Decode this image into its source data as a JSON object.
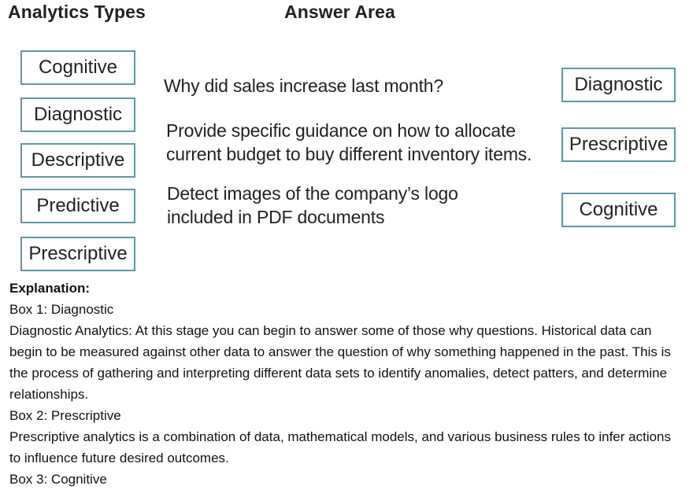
{
  "headings": {
    "analytics_types": "Analytics Types",
    "answer_area": "Answer Area"
  },
  "source_options": [
    "Cognitive",
    "Diagnostic",
    "Descriptive",
    "Predictive",
    "Prescriptive"
  ],
  "questions": [
    {
      "line1": "Why did sales increase last month?",
      "line2": ""
    },
    {
      "line1": "Provide specific guidance on how to allocate",
      "line2": "current budget to buy different inventory items."
    },
    {
      "line1": "Detect images of the company’s logo",
      "line2": "included in PDF documents"
    }
  ],
  "answers": [
    "Diagnostic",
    "Prescriptive",
    "Cognitive"
  ],
  "explanation": {
    "title": "Explanation:",
    "paragraphs": [
      "Box 1: Diagnostic",
      "Diagnostic Analytics: At this stage you can begin to answer some of those why questions. Historical data can begin to be measured against other data to answer the question of why something happened in the past. This is the process of gathering and interpreting different data sets to identify anomalies, detect patters, and determine relationships.",
      "Box 2: Prescriptive",
      "Prescriptive analytics is a combination of data, mathematical models, and various business rules to infer actions to influence future desired outcomes.",
      "Box 3: Cognitive"
    ]
  },
  "colors": {
    "box_border": "#5d97a8"
  }
}
